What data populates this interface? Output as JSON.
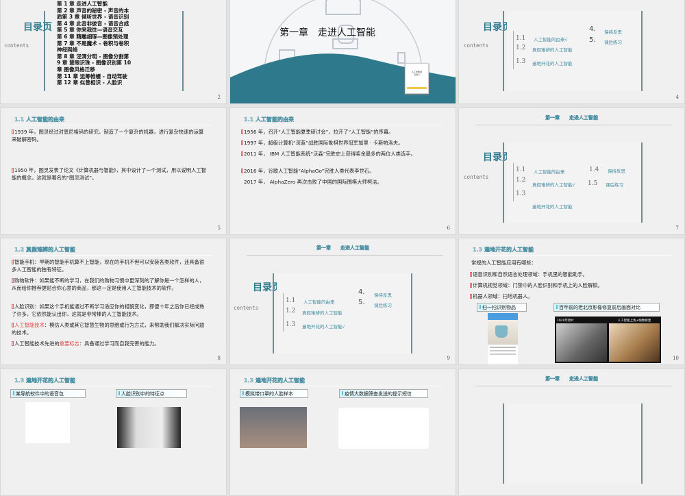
{
  "slides": {
    "s2": {
      "title": "目录页",
      "contents": "contents",
      "page": "2",
      "chapters": [
        "第 1 章 走进人工智能",
        "第 2 章 声音的秘密 - 声音的本质第 3 章 倾听世界 - 语音识别",
        "第 4 章 此音非彼音 - 语音合成",
        "第 5 章 你来我往—语音交互",
        "第 6 章 精雕细琢—图像预处理",
        "第 7 章 不是魔术 - 卷积与卷积神经网络",
        "第 8 章 泾渭分明 - 图像分割第 9 章 慧眼识珠 - 图像识别第 10 章 图像风格迁移",
        "第 11 章 运筹帷幄 - 自动驾驶",
        "第 12 章 似曾相识 - 人脸识"
      ]
    },
    "s3": {
      "title": "第一章　走进人工智能",
      "book": "人工智能通识讲义"
    },
    "s4": {
      "title": "目录页",
      "contents": "contents",
      "page": "4",
      "items": [
        {
          "num": "1.1",
          "label": "人工智能的由来√"
        },
        {
          "num": "1.2",
          "label": "真假难辨的人工智能"
        },
        {
          "num": "1.3",
          "label": "遍地开花的人工智能"
        },
        {
          "num": "4.",
          "label": "保持反思"
        },
        {
          "num": "5.",
          "label": "课后练习"
        }
      ]
    },
    "s5": {
      "section": "1.1  人工智能的由来",
      "page": "5",
      "bullets": [
        "1939 年，图灵经过对恩尼格码的研究，制造了一个复杂的机器，进行复杂快速的运算来破解密码。",
        "1950 年，图灵发表了论文《计算机器与智能》，其中设计了一个测试，用以说明人工智能的概念，这就是著名的“图灵测试”。"
      ]
    },
    "s6": {
      "section": "1.1  人工智能的由来",
      "page": "6",
      "bullets": [
        "1956 年，召开“人工智能夏季研讨会”，拉开了“人工智能”的序幕。",
        "1997 年，超级计算机“深蓝”战胜国际象棋世界冠军加里 · 卡斯帕洛夫。",
        "2011 年， IBM 人工智能系统“沃森”完胜史上获得奖金最多的两位人类选手。",
        "2016 年，谷歌人工智能“AlphaGo”完胜人类代表李世石。",
        "2017 年， AlphaZero 再次击败了中国的国际围棋大师柯洁。"
      ]
    },
    "s7": {
      "header": "第一章　　走进人工智能",
      "title": "目录页",
      "contents": "contents",
      "page": "7",
      "items": [
        {
          "num": "1.1",
          "label": "人工智能的由来"
        },
        {
          "num": "1.2",
          "label": "真假难辨的人工智能√"
        },
        {
          "num": "1.3",
          "label": "遍地开花的人工智能"
        },
        {
          "num": "1.4",
          "label": "保持反思"
        },
        {
          "num": "1.5",
          "label": "课后练习"
        }
      ]
    },
    "s8": {
      "section": "1.2  真假难辨的人工智能",
      "page": "8",
      "b1": "智能手机：早期的智能手机算不上智能，现在的手机不但可以安装各类软件，还具备很多人工智能的独有特征。",
      "b2": "购物软件：如果能不断的学习，在我们的购物习惯中更深刻的了解你是一个怎样的人，从而给你推荐更贴合你心意的商品，那这一定是使用人工智能技术的软件。",
      "b3": "人脸识别：如果这个手机能通过不断学习适应你的相貌变化，即便十年之后你已经成熟了许多，它依然能认出你，这就是非常棒的人工智能技术。",
      "b4_red": "人工智能技术",
      "b4": "：模仿人类或其它智慧生物的思维或行为方式，来帮助我们解决实际问题的技术。",
      "b5a": "人工智能技术先进的",
      "b5_red": "重要标志",
      "b5b": "：具备通过学习而自我完善的能力。"
    },
    "s9": {
      "header": "第一章　　走进人工智能",
      "title": "目录页",
      "contents": "contents",
      "page": "9",
      "items": [
        {
          "num": "1.1",
          "label": "人工智能的由来"
        },
        {
          "num": "1.2",
          "label": "真假难辨的人工智能"
        },
        {
          "num": "1.3",
          "label": "遍地开花的人工智能√"
        },
        {
          "num": "4.",
          "label": "保持反思"
        },
        {
          "num": "5.",
          "label": "课后练习"
        }
      ]
    },
    "s10": {
      "section": "1.3  遍地开花的人工智能",
      "page": "10",
      "intro": "常规的人工智能应用有哪些：",
      "bullets": [
        "语音识别和自然语言处理领域：手机里的智能助手。",
        "计算机视觉领域：门禁中的人脸识别和手机上的人脸解锁。",
        "机器人领域：扫地机器人。"
      ],
      "cap1": "扫一扫识别物品",
      "cap2": "百年前的老北京影像修复前后画面对比",
      "photo_left": "1920年原片",
      "photo_right": "人工智能上色+帧数修复"
    },
    "s11": {
      "section": "1.3  遍地开花的人工智能",
      "cap1": "某导航软件中的语音包",
      "cap2": "人脸识别中的特征点"
    },
    "s12": {
      "section": "1.3  遍地开花的人工智能",
      "cap1": "模拟带口罩的人脸样本",
      "cap2": "疫情大数据筛查发送的提示短信"
    },
    "s13": {
      "header": "第一章　　走进人工智能"
    }
  },
  "colors": {
    "teal": "#2d7a8f",
    "wave": "#2e7a8c",
    "accent_red": "#e0474c"
  }
}
